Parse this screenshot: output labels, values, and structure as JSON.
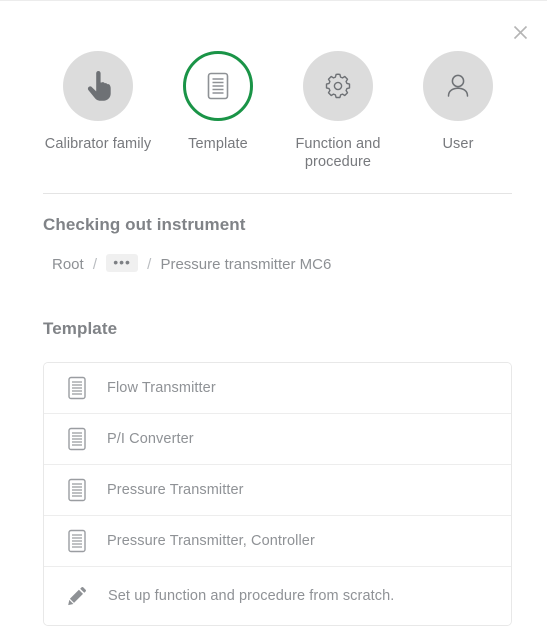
{
  "dialog": {
    "close_label": "Close",
    "close_icon": "close-icon"
  },
  "stepper": {
    "steps": [
      {
        "label": "Calibrator family",
        "icon": "hand-touch-icon",
        "active": false
      },
      {
        "label": "Template",
        "icon": "document-icon",
        "active": true
      },
      {
        "label": "Function and procedure",
        "icon": "gear-icon",
        "active": false
      },
      {
        "label": "User",
        "icon": "user-icon",
        "active": false
      }
    ],
    "active_color": "#1a9447",
    "inactive_bg": "#dcdcdc"
  },
  "checkout": {
    "heading": "Checking out instrument",
    "breadcrumb": {
      "root": "Root",
      "separator": "/",
      "ellipsis": "•••",
      "current": "Pressure transmitter MC6"
    }
  },
  "template_section": {
    "heading": "Template",
    "items": [
      {
        "label": "Flow Transmitter",
        "icon": "document-icon"
      },
      {
        "label": "P/I Converter",
        "icon": "document-icon"
      },
      {
        "label": "Pressure Transmitter",
        "icon": "document-icon"
      },
      {
        "label": "Pressure Transmitter, Controller",
        "icon": "document-icon"
      },
      {
        "label": "Set up function and procedure from scratch.",
        "icon": "pencil-icon"
      }
    ]
  }
}
